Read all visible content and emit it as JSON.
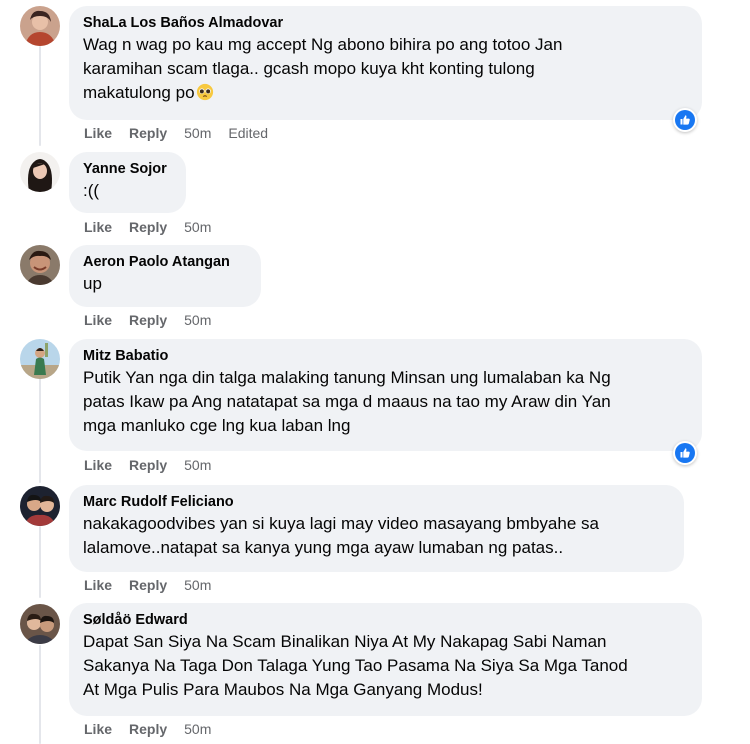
{
  "labels": {
    "like": "Like",
    "reply": "Reply"
  },
  "colors": {
    "bubble_bg": "#f0f2f5",
    "like_blue": "#1877f2",
    "meta_gray": "#65676b"
  },
  "comments": [
    {
      "author": "ShaLa Los Baños Almadovar",
      "text": "Wag n wag po kau mg accept Ng abono bihira po ang totoo Jan\nkaramihan scam tlaga.. gcash mopo kuya kht konting tulong\nmakatulong po",
      "emoji": "pleading-face",
      "time": "50m",
      "edited": "Edited",
      "reaction": "like"
    },
    {
      "author": "Yanne Sojor",
      "text": ":((",
      "time": "50m"
    },
    {
      "author": "Aeron Paolo Atangan",
      "text": "up",
      "time": "50m"
    },
    {
      "author": "Mitz Babatio",
      "text": "Putik Yan nga din talga malaking tanung Minsan ung lumalaban ka Ng\npatas Ikaw pa Ang natatapat sa mga d maaus na tao my Araw din Yan\nmga manluko cge lng kua laban lng",
      "time": "50m",
      "reaction": "like"
    },
    {
      "author": "Marc Rudolf Feliciano",
      "text": "nakakagoodvibes yan si kuya lagi may video masayang bmbyahe sa\nlalamove..natapat sa kanya yung mga ayaw lumaban ng patas..",
      "time": "50m"
    },
    {
      "author": "Søldåö Edward",
      "text": "Dapat San Siya Na Scam Binalikan Niya At My Nakapag Sabi Naman\nSakanya Na Taga Don Talaga Yung Tao Pasama Na Siya Sa Mga Tanod\nAt Mga Pulis Para Maubos Na Mga Ganyang Modus!",
      "time": "50m"
    }
  ]
}
